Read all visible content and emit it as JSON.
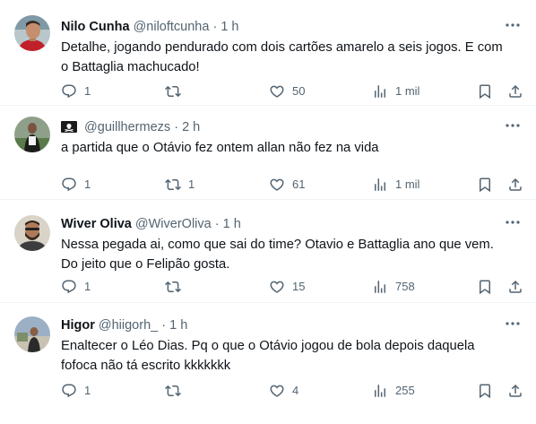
{
  "tweets": [
    {
      "name": "Nilo Cunha",
      "handle": "@niloftcunha",
      "dot": "·",
      "time": "1 h",
      "text_lines": [
        "Detalhe, jogando pendurado com dois cartões amarelo a seis jogos. E com",
        "o Battaglia machucado!"
      ],
      "replies": "1",
      "retweets": "",
      "likes": "50",
      "views": "1 mil",
      "avatar": "avatar-photo-red-shirt"
    },
    {
      "name": "",
      "name_icon": "pirate-flag-icon",
      "handle": "@guillhermezs",
      "dot": "·",
      "time": "2 h",
      "text_lines": [
        "a partida que o Otávio fez ontem allan não fez na vida"
      ],
      "replies": "1",
      "retweets": "1",
      "likes": "61",
      "views": "1 mil",
      "avatar": "avatar-photo-soccer-player"
    },
    {
      "name": "Wiver Oliva",
      "handle": "@WiverOliva",
      "dot": "·",
      "time": "1 h",
      "text_lines": [
        "Nessa pegada ai, como que sai do time? Otavio e Battaglia ano que vem.",
        "Do jeito que o Felipão gosta."
      ],
      "replies": "1",
      "retweets": "",
      "likes": "15",
      "views": "758",
      "avatar": "avatar-photo-bearded-man"
    },
    {
      "name": "Higor",
      "handle": "@hiigorh_",
      "dot": "·",
      "time": "1 h",
      "text_lines": [
        "Enaltecer o Léo Dias. Pq o que o Otávio jogou de bola depois daquela",
        "fofoca não tá escrito kkkkkkk"
      ],
      "replies": "1",
      "retweets": "",
      "likes": "4",
      "views": "255",
      "avatar": "avatar-photo-outdoor"
    }
  ],
  "colors": {
    "text": "#0f1419",
    "secondary": "#536471",
    "divider": "#eff3f4"
  }
}
